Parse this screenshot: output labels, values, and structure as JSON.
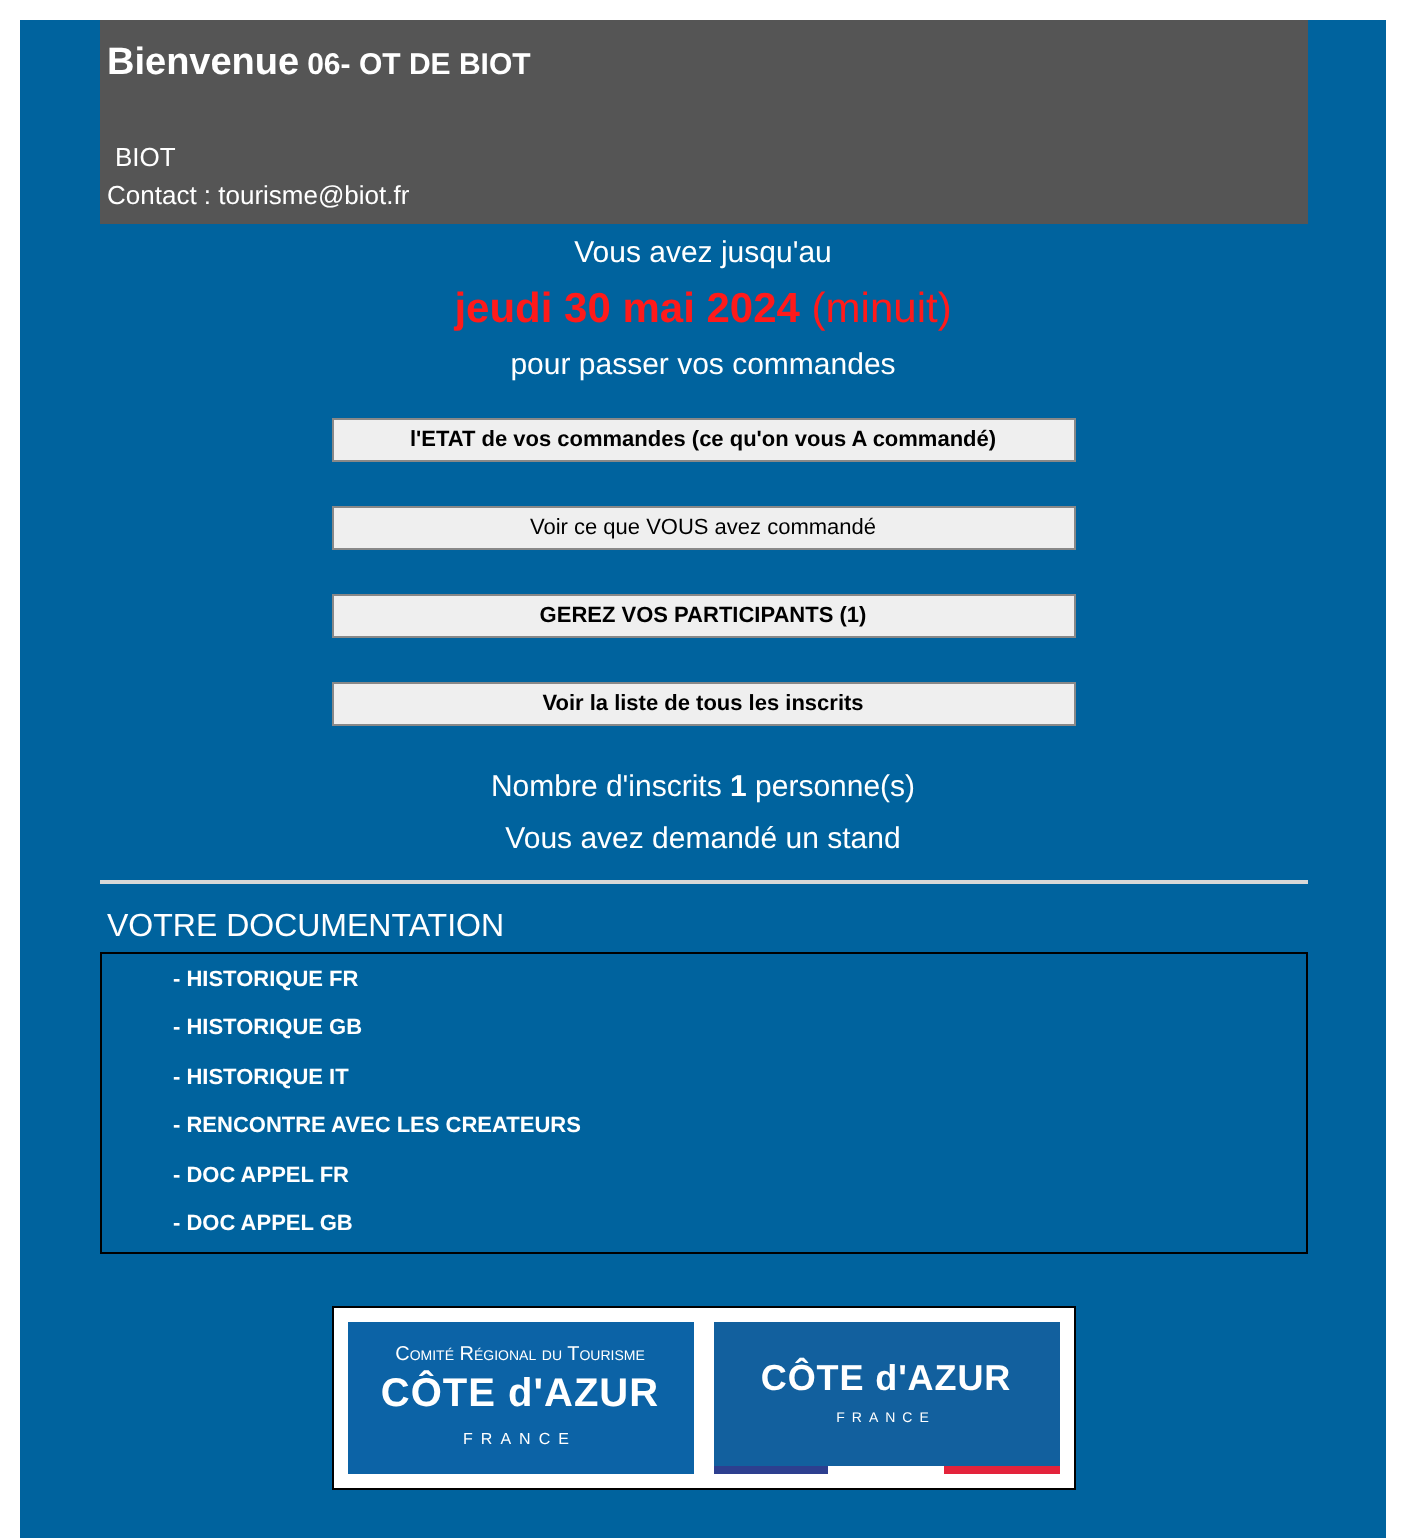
{
  "header": {
    "greeting": "Bienvenue",
    "organisation": "06- OT DE BIOT",
    "city": "BIOT",
    "contact": "Contact : tourisme@biot.fr"
  },
  "deadline": {
    "intro": "Vous avez jusqu'au",
    "date": "**jeudi 30 mai 2024** (minuit)",
    "outro": "pour passer vos commandes"
  },
  "buttons": [
    {
      "label": "l'ETAT de vos commandes (ce qu'on vous A commandé)",
      "bold": true
    },
    {
      "label": "Voir ce que VOUS avez commandé",
      "bold": false
    },
    {
      "label": "GEREZ VOS PARTICIPANTS (1)",
      "bold": true
    },
    {
      "label": "Voir la liste de tous les inscrits",
      "bold": true
    }
  ],
  "summary": [
    "Nombre d'inscrits **1** personne(s)",
    "Vous avez demandé un stand"
  ],
  "documentation": {
    "title": "VOTRE DOCUMENTATION",
    "items": [
      "- HISTORIQUE FR",
      "- HISTORIQUE GB",
      "- HISTORIQUE IT",
      "- RENCONTRE AVEC LES CREATEURS",
      "- DOC APPEL FR",
      "- DOC APPEL GB"
    ]
  },
  "logos": [
    {
      "kind": "regional",
      "lines": [
        "Comité Régional du Tourisme",
        "CÔTE d'AZUR",
        "FRANCE"
      ]
    },
    {
      "kind": "brand",
      "lines": [
        "CÔTE d'AZUR",
        "FRANCE"
      ]
    }
  ]
}
